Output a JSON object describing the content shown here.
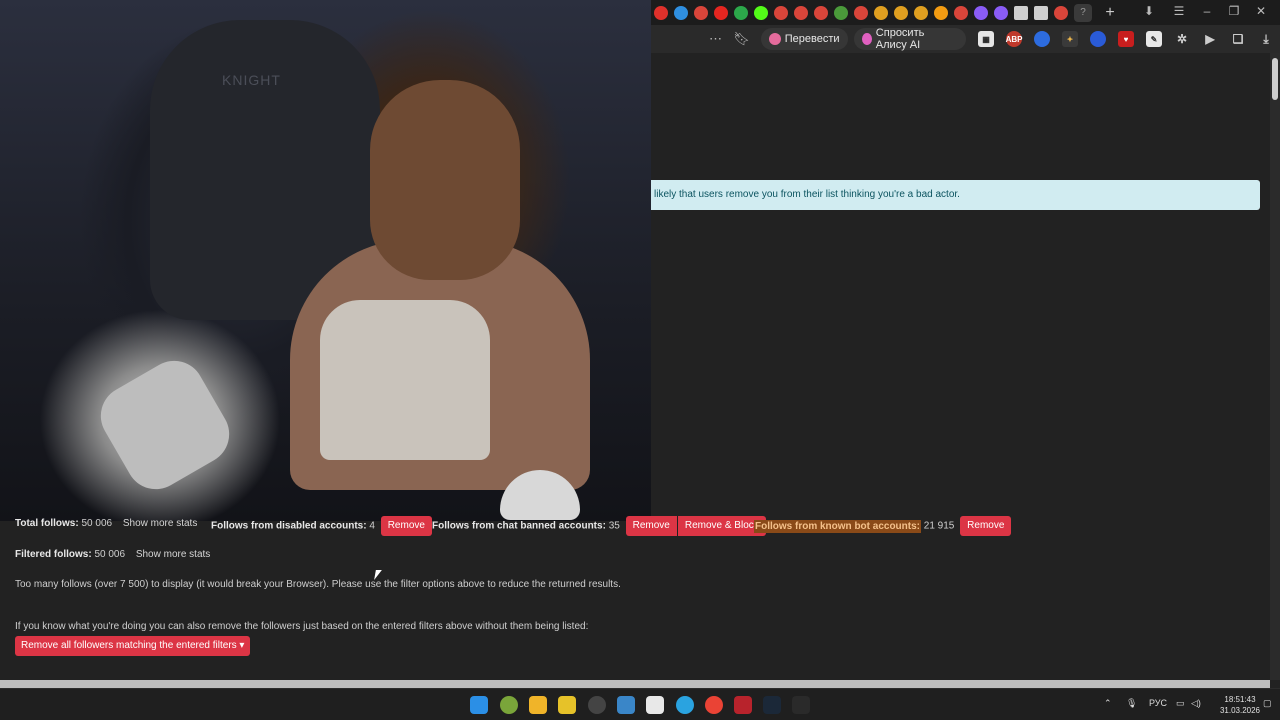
{
  "browser": {
    "new_tab_label": "+",
    "toolbar": {
      "translate_label": "Перевести",
      "ask_alice_label": "Спросить Алису AI",
      "abp_label": "ABP"
    }
  },
  "page": {
    "notice": "likely that users remove you from their list thinking you're a bad actor.",
    "total_follows_label": "Total follows:",
    "total_follows_value": "50 006",
    "show_more_stats": "Show more stats",
    "disabled_label": "Follows from disabled accounts:",
    "disabled_value": "4",
    "chat_banned_label": "Follows from chat banned accounts:",
    "chat_banned_value": "35",
    "bot_label": "Follows from known bot accounts:",
    "bot_value": "21 915",
    "remove_label": "Remove",
    "remove_block_label": "Remove & Block",
    "filtered_follows_label": "Filtered follows:",
    "filtered_follows_value": "50 006",
    "too_many_text": "Too many follows (over 7 500) to display (it would break your Browser). Please use the filter options above to reduce the returned results.",
    "know_what_text": "If you know what you're doing you can also remove the followers just based on the entered filters above without them being listed:",
    "remove_all_label": "Remove all followers matching the entered filters ▾"
  },
  "taskbar": {
    "language": "РУС",
    "time": "18:51:43",
    "date": "31.03.2026"
  },
  "colors": {
    "page_bg": "#222222",
    "danger": "#dc3545",
    "alert_bg": "#d1ecf1",
    "highlight_bg": "#8a4a18"
  }
}
